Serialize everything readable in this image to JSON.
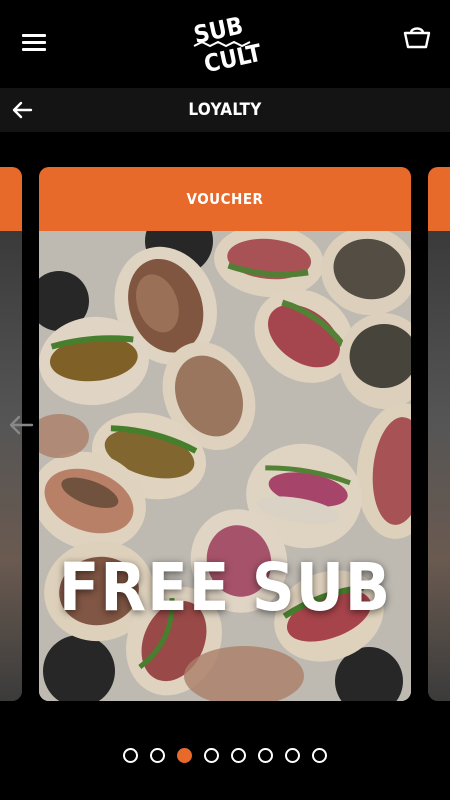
{
  "header": {
    "menu_icon": "hamburger-menu-icon",
    "logo_text_top": "SUB",
    "logo_text_bottom": "CULT",
    "basket_icon": "shopping-basket-icon"
  },
  "subheader": {
    "back_icon": "arrow-left-icon",
    "title": "LOYALTY"
  },
  "carousel": {
    "prev_icon": "arrow-left-icon",
    "accent_color": "#e86a2a",
    "card": {
      "title": "VOUCHER",
      "headline": "FREE SUB",
      "image": "sandwiches-photo"
    },
    "pagination": {
      "count": 8,
      "active_index": 2,
      "active_color": "#e86a2a"
    }
  }
}
